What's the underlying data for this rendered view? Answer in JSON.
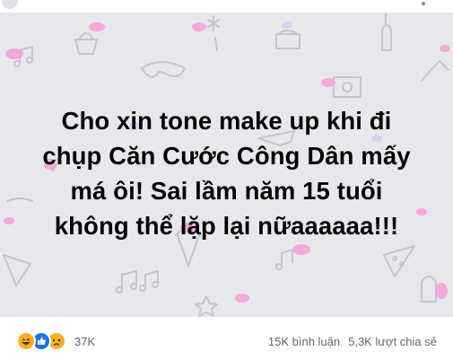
{
  "post": {
    "lines": [
      "Cho xin tone make up khi đi",
      "chụp Căn Cước Công Dân mấy",
      "má ôi! Sai lầm năm 15 tuổi",
      "không thể lặp lại nữaaaaaa!!!"
    ],
    "background_color": "#e7e8ec",
    "doodle_accent": "#f5a3d8"
  },
  "reactions": {
    "icons": [
      "haha-icon",
      "like-icon",
      "sad-icon"
    ],
    "count": "37K"
  },
  "stats": {
    "comments": "15K bình luận",
    "shares": "5,3K lượt chia sẻ"
  }
}
